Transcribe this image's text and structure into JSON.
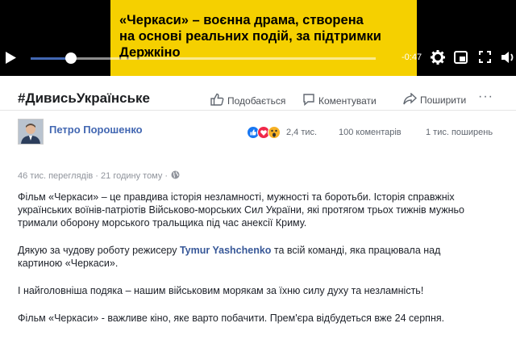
{
  "video": {
    "overlay_text": "«Черкаси» – воєнна драма, створена\nна основі реальних подій, за підтримки\nДержкіно",
    "time_remaining": "-0:47",
    "progress": 0.117
  },
  "actions": {
    "hashtag": "#ДивисьУкраїнське",
    "like_label": "Подобається",
    "comment_label": "Коментувати",
    "share_label": "Поширити",
    "more_label": "···"
  },
  "post": {
    "author": "Петро Порошенко",
    "reactions_count": "2,4 тис.",
    "comments_count": "100 коментарів",
    "shares_count": "1 тис. поширень",
    "meta": "46 тис. переглядів · 21 годину тому ·",
    "p1": "Фільм «Черкаси» – це правдива історія незламності, мужності та боротьби. Історія справжніх українських воїнів-патріотів Військово-морських Сил України, які протягом трьох тижнів мужньо тримали оборону морського тральщика під час анексії Криму.",
    "p2_before": "Дякую за чудову роботу режисеру ",
    "p2_mention": "Tymur Yashchenko",
    "p2_after": " та всій команді, яка працювала над картиною «Черкаси».",
    "p3": "І найголовніша подяка – нашим військовим морякам за їхню силу духу та незламність!",
    "p4": "Фільм «Черкаси» - важливе кіно, яке варто побачити. Прем'єра відбудеться вже 24 серпня."
  },
  "colors": {
    "facebook_blue": "#4267b2",
    "overlay_yellow": "#f5d000",
    "like": "#1877f2",
    "love": "#f0284a",
    "wow": "#f7b125"
  }
}
